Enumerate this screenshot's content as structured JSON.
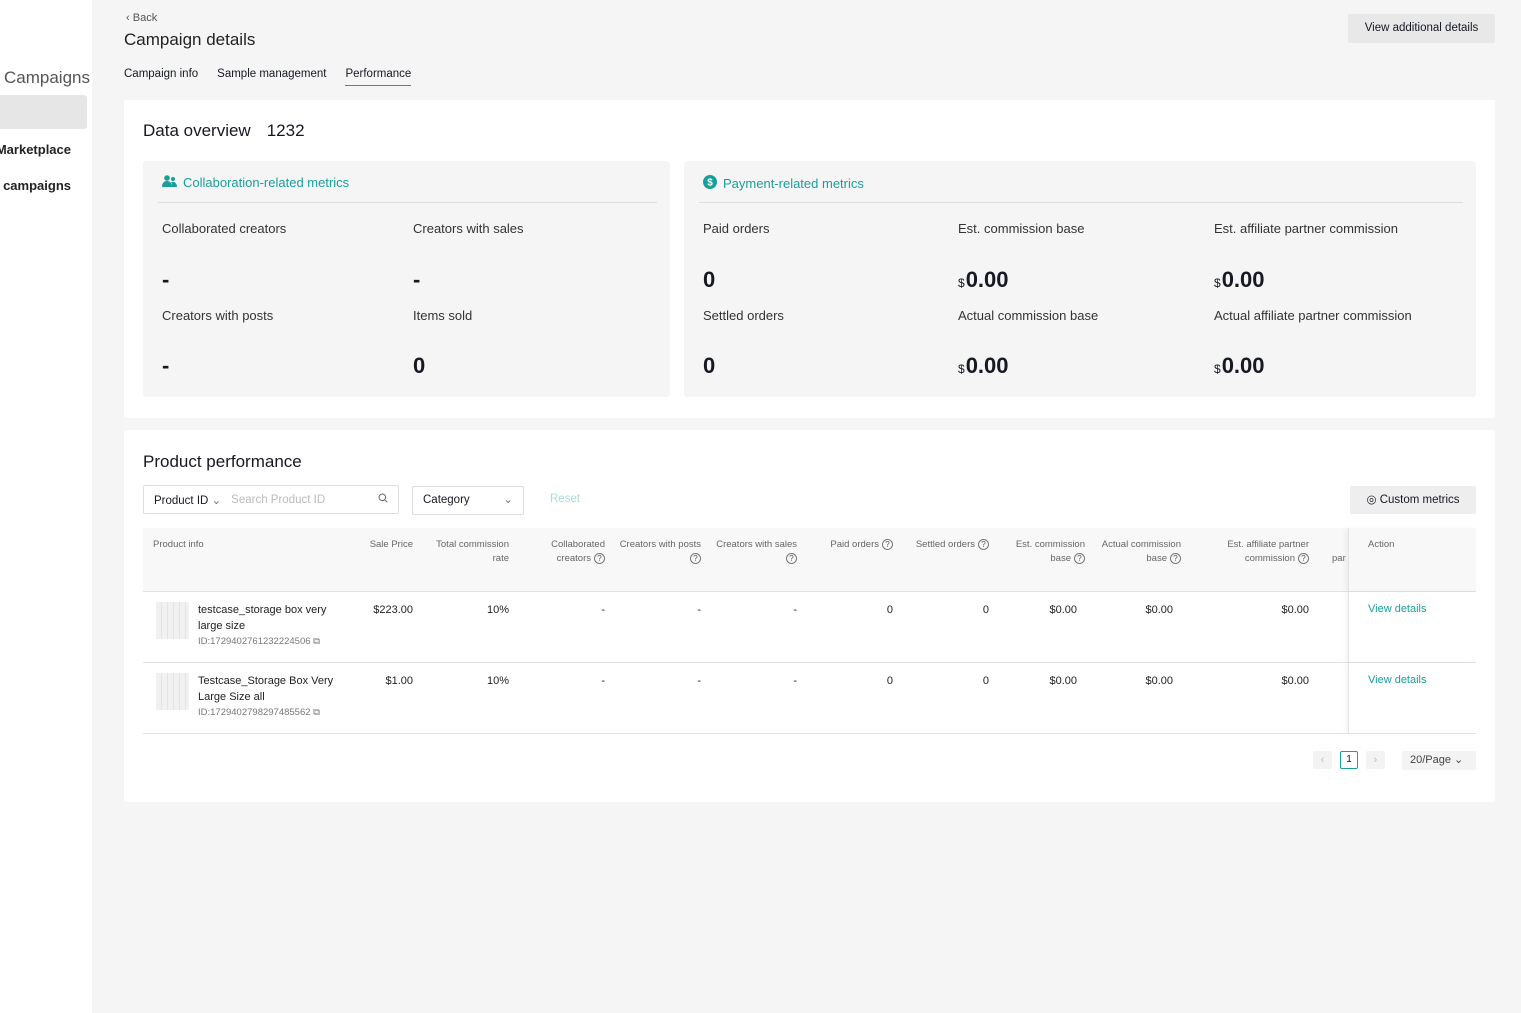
{
  "sidebar": {
    "title": "Campaigns",
    "items": [
      "Marketplace",
      "Ongoing campaigns"
    ]
  },
  "header": {
    "back": "Back",
    "title": "Campaign details",
    "view_additional": "View additional details"
  },
  "tabs": [
    {
      "label": "Campaign info"
    },
    {
      "label": "Sample management"
    },
    {
      "label": "Performance",
      "active": true
    }
  ],
  "overview": {
    "title": "Data overview",
    "count": "1232",
    "collab": {
      "title": "Collaboration-related metrics",
      "metrics": [
        {
          "label": "Collaborated creators",
          "value": "-"
        },
        {
          "label": "Creators with sales",
          "value": "-"
        },
        {
          "label": "Creators with posts",
          "value": "-"
        },
        {
          "label": "Items sold",
          "value": "0"
        }
      ]
    },
    "payment": {
      "title": "Payment-related metrics",
      "currency": "$",
      "metrics": [
        {
          "label": "Paid orders",
          "value": "0"
        },
        {
          "label": "Est. commission base",
          "value": "0.00"
        },
        {
          "label": "Est. affiliate partner commission",
          "value": "0.00"
        },
        {
          "label": "Settled orders",
          "value": "0"
        },
        {
          "label": "Actual commission base",
          "value": "0.00"
        },
        {
          "label": "Actual affiliate partner commission",
          "value": "0.00"
        }
      ]
    }
  },
  "product": {
    "title": "Product performance",
    "search_type": "Product ID",
    "search_placeholder": "Search Product ID",
    "category": "Category",
    "reset": "Reset",
    "custom_metrics": "Custom metrics",
    "columns": [
      "Product info",
      "Sale Price",
      "Total commission rate",
      "Collaborated creators",
      "Creators with posts",
      "Creators with sales",
      "Paid orders",
      "Settled orders",
      "Est. commission base",
      "Actual commission base",
      "Est. affiliate partner commission",
      "par",
      "Action"
    ],
    "rows": [
      {
        "name": "testcase_storage box very large size",
        "id": "ID:1729402761232224506",
        "cells": [
          "$223.00",
          "10%",
          "-",
          "-",
          "-",
          "0",
          "0",
          "$0.00",
          "$0.00",
          "$0.00"
        ],
        "action": "View details"
      },
      {
        "name": "Testcase_Storage Box Very Large Size all",
        "id": "ID:1729402798297485562",
        "cells": [
          "$1.00",
          "10%",
          "-",
          "-",
          "-",
          "0",
          "0",
          "$0.00",
          "$0.00",
          "$0.00"
        ],
        "action": "View details"
      }
    ],
    "pagination": {
      "page": "1",
      "page_size": "20/Page"
    }
  },
  "colors": {
    "accent": "#1a9e9a"
  }
}
